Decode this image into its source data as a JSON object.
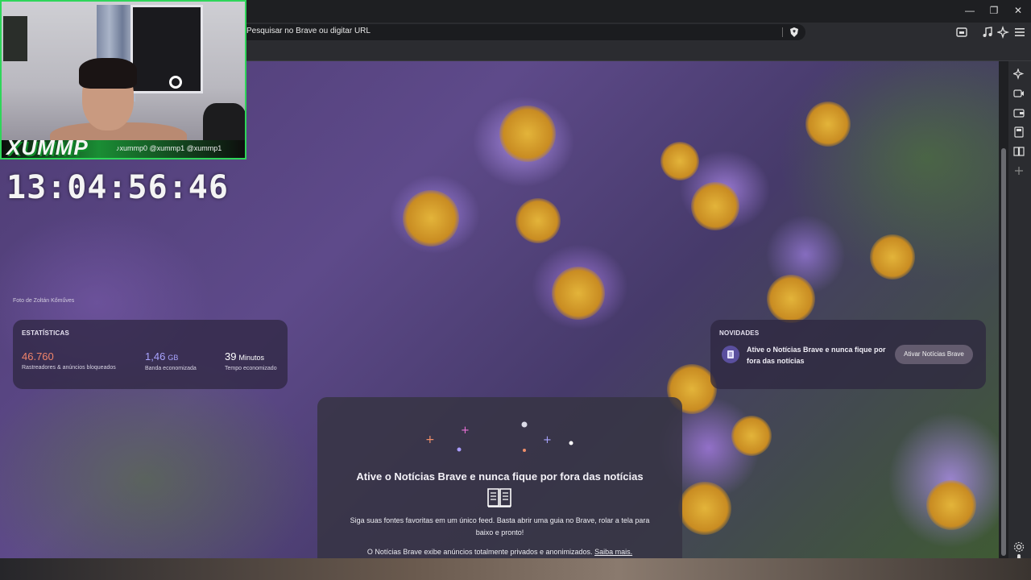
{
  "browser": {
    "address_placeholder": "Pesquisar no Brave ou digitar URL"
  },
  "background": {
    "photo_credit": "Foto de Zoltán Kőműves"
  },
  "stats": {
    "heading": "ESTATÍSTICAS",
    "items": [
      {
        "value": "46.760",
        "unit": "",
        "label": "Rastreadores & anúncios bloqueados",
        "color": "#f0846a"
      },
      {
        "value": "1,46",
        "unit": "GB",
        "label": "Banda economizada",
        "color": "#a9a4ff"
      },
      {
        "value": "39",
        "unit": "Minutos",
        "label": "Tempo economizado",
        "color": "#ffffff"
      }
    ]
  },
  "news": {
    "heading": "NOVIDADES",
    "message": "Ative o Notícias Brave e nunca fique por fora das notícias",
    "button_label": "Ativar Notícias Brave"
  },
  "news_promo": {
    "title": "Ative o Notícias Brave e nunca fique por fora das notícias",
    "description": "Siga suas fontes favoritas em um único feed. Basta abrir uma guia no Brave, rolar a tela para baixo e pronto!",
    "privacy_note": "O Notícias Brave exibe anúncios totalmente privados e anonimizados.",
    "link_label": "Saiba mais."
  },
  "stream": {
    "logo_text": "XUMMP",
    "handles": "♪xummp0 @xummp1 @xummp1",
    "timer": "13:04:56:46",
    "border_color": "#2fd65a"
  },
  "icons": [
    "minimize-icon",
    "restore-icon",
    "close-icon",
    "brave-shield-icon",
    "tab-manager-icon",
    "music-icon",
    "leo-ai-icon",
    "menu-icon",
    "news-icon",
    "news-book-icon"
  ]
}
